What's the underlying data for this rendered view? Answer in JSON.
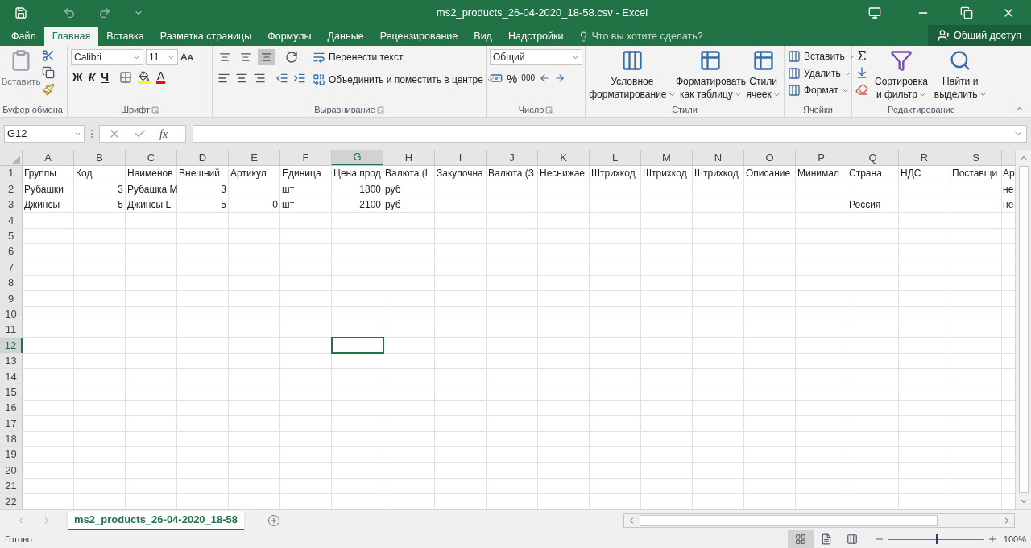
{
  "window": {
    "title": "ms2_products_26-04-2020_18-58.csv - Excel"
  },
  "tabs": [
    {
      "label": "Файл",
      "selected": false
    },
    {
      "label": "Главная",
      "selected": true
    },
    {
      "label": "Вставка",
      "selected": false
    },
    {
      "label": "Разметка страницы",
      "selected": false
    },
    {
      "label": "Формулы",
      "selected": false
    },
    {
      "label": "Данные",
      "selected": false
    },
    {
      "label": "Рецензирование",
      "selected": false
    },
    {
      "label": "Вид",
      "selected": false
    },
    {
      "label": "Надстройки",
      "selected": false
    }
  ],
  "tell_me": {
    "placeholder": "Что вы хотите сделать?"
  },
  "share_button": {
    "label": "Общий доступ"
  },
  "ribbon": {
    "clipboard": {
      "paste": "Вставить",
      "label": "Буфер обмена"
    },
    "font": {
      "name": "Calibri",
      "size": "11",
      "bold": "Ж",
      "italic": "К",
      "underline": "Ч",
      "font_color": "A",
      "label": "Шрифт"
    },
    "alignment": {
      "vertical": [
        {
          "selected": false
        },
        {
          "selected": false
        },
        {
          "selected": true
        }
      ],
      "wrap": "Перенести текст",
      "merge": "Объединить и поместить в центре",
      "label": "Выравнивание"
    },
    "number": {
      "format": "Общий",
      "percent": "%",
      "thousands": "000",
      "label": "Число"
    },
    "styles": {
      "buttons": [
        {
          "line1": "Условное",
          "line2": "форматирование"
        },
        {
          "line1": "Форматировать",
          "line2": "как таблицу"
        },
        {
          "line1": "Стили",
          "line2": "ячеек"
        }
      ],
      "label": "Стили"
    },
    "cells": {
      "buttons": [
        "Вставить",
        "Удалить",
        "Формат"
      ],
      "label": "Ячейки"
    },
    "editing": {
      "buttons": [
        {
          "line1": "Сортировка",
          "line2": "и фильтр"
        },
        {
          "line1": "Найти и",
          "line2": "выделить"
        }
      ],
      "label": "Редактирование"
    }
  },
  "formula_bar": {
    "name_box": "G12",
    "fx": "fx"
  },
  "sheet": {
    "columns": [
      {
        "letter": "A",
        "selected": false
      },
      {
        "letter": "B",
        "selected": false
      },
      {
        "letter": "C",
        "selected": false
      },
      {
        "letter": "D",
        "selected": false
      },
      {
        "letter": "E",
        "selected": false
      },
      {
        "letter": "F",
        "selected": false
      },
      {
        "letter": "G",
        "selected": true
      },
      {
        "letter": "H",
        "selected": false
      },
      {
        "letter": "I",
        "selected": false
      },
      {
        "letter": "J",
        "selected": false
      },
      {
        "letter": "K",
        "selected": false
      },
      {
        "letter": "L",
        "selected": false
      },
      {
        "letter": "M",
        "selected": false
      },
      {
        "letter": "N",
        "selected": false
      },
      {
        "letter": "O",
        "selected": false
      },
      {
        "letter": "P",
        "selected": false
      },
      {
        "letter": "Q",
        "selected": false
      },
      {
        "letter": "R",
        "selected": false
      },
      {
        "letter": "S",
        "selected": false
      }
    ],
    "rows": [
      {
        "number": "1",
        "selected": false,
        "cells": [
          {
            "kind": "text",
            "text": "Группы"
          },
          {
            "kind": "text",
            "text": "Код"
          },
          {
            "kind": "text",
            "text": "Наименов"
          },
          {
            "kind": "text",
            "text": "Внешний"
          },
          {
            "kind": "text",
            "text": "Артикул"
          },
          {
            "kind": "text",
            "text": "Единица"
          },
          {
            "kind": "text",
            "text": "Цена прод"
          },
          {
            "kind": "text",
            "text": "Валюта (L"
          },
          {
            "kind": "text",
            "text": "Закупочна"
          },
          {
            "kind": "text",
            "text": "Валюта (З"
          },
          {
            "kind": "text",
            "text": "Неснижае"
          },
          {
            "kind": "text",
            "text": "Штрихкод"
          },
          {
            "kind": "text",
            "text": "Штрихкод"
          },
          {
            "kind": "text",
            "text": "Штрихкод"
          },
          {
            "kind": "text",
            "text": "Описание"
          },
          {
            "kind": "text",
            "text": "Минимал"
          },
          {
            "kind": "text",
            "text": "Страна"
          },
          {
            "kind": "text",
            "text": "НДС"
          },
          {
            "kind": "text",
            "text": "Поставщи"
          },
          {
            "kind": "text",
            "text": "Ар"
          }
        ]
      },
      {
        "number": "2",
        "selected": false,
        "cells": [
          {
            "kind": "text",
            "text": "Рубашки"
          },
          {
            "kind": "number",
            "text": "3"
          },
          {
            "kind": "text",
            "text": "Рубашка М"
          },
          {
            "kind": "number",
            "text": "3"
          },
          null,
          {
            "kind": "text",
            "text": "шт"
          },
          {
            "kind": "number",
            "text": "1800"
          },
          {
            "kind": "text",
            "text": "руб"
          },
          null,
          null,
          null,
          null,
          null,
          null,
          null,
          null,
          null,
          null,
          null,
          {
            "kind": "text",
            "text": "не"
          }
        ]
      },
      {
        "number": "3",
        "selected": false,
        "cells": [
          {
            "kind": "text",
            "text": "Джинсы"
          },
          {
            "kind": "number",
            "text": "5"
          },
          {
            "kind": "text",
            "text": "Джинсы L"
          },
          {
            "kind": "number",
            "text": "5"
          },
          {
            "kind": "number",
            "text": "0"
          },
          {
            "kind": "text",
            "text": "шт"
          },
          {
            "kind": "number",
            "text": "2100"
          },
          {
            "kind": "text",
            "text": "руб"
          },
          null,
          null,
          null,
          null,
          null,
          null,
          null,
          null,
          {
            "kind": "text",
            "text": "Россия"
          },
          null,
          null,
          {
            "kind": "text",
            "text": "не"
          }
        ]
      },
      {
        "number": "4",
        "selected": false,
        "cells": []
      },
      {
        "number": "5",
        "selected": false,
        "cells": []
      },
      {
        "number": "6",
        "selected": false,
        "cells": []
      },
      {
        "number": "7",
        "selected": false,
        "cells": []
      },
      {
        "number": "8",
        "selected": false,
        "cells": []
      },
      {
        "number": "9",
        "selected": false,
        "cells": []
      },
      {
        "number": "10",
        "selected": false,
        "cells": []
      },
      {
        "number": "11",
        "selected": false,
        "cells": []
      },
      {
        "number": "12",
        "selected": true,
        "cells": []
      },
      {
        "number": "13",
        "selected": false,
        "cells": []
      },
      {
        "number": "14",
        "selected": false,
        "cells": []
      },
      {
        "number": "15",
        "selected": false,
        "cells": []
      },
      {
        "number": "16",
        "selected": false,
        "cells": []
      },
      {
        "number": "17",
        "selected": false,
        "cells": []
      },
      {
        "number": "18",
        "selected": false,
        "cells": []
      },
      {
        "number": "19",
        "selected": false,
        "cells": []
      },
      {
        "number": "20",
        "selected": false,
        "cells": []
      },
      {
        "number": "21",
        "selected": false,
        "cells": []
      },
      {
        "number": "22",
        "selected": false,
        "cells": []
      }
    ]
  },
  "sheet_tabs": [
    {
      "label": "ms2_products_26-04-2020_18-58",
      "selected": true
    }
  ],
  "status_bar": {
    "status": "Готово",
    "views": [
      {
        "selected": true
      },
      {
        "selected": false
      },
      {
        "selected": false
      }
    ],
    "zoom": {
      "level": 0.5
    },
    "zoom_label": "100%"
  }
}
